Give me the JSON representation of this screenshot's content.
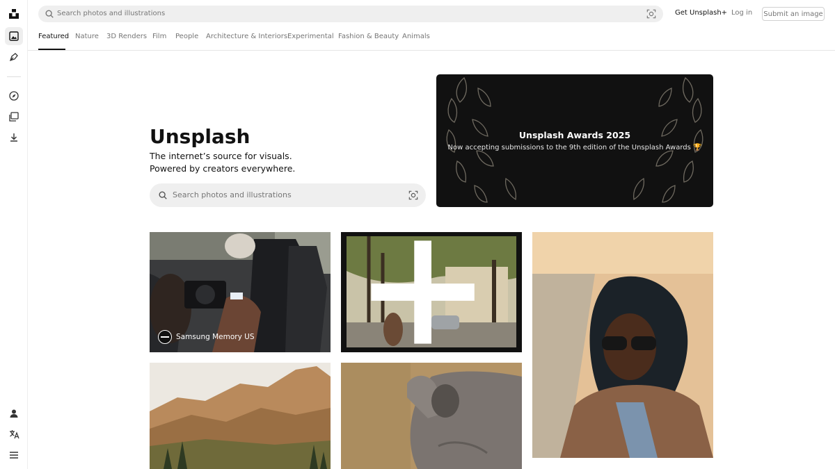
{
  "header": {
    "search_placeholder": "Search photos and illustrations",
    "get_plus": "Get Unsplash+",
    "login": "Log in",
    "submit": "Submit an image"
  },
  "tabs": [
    "Featured",
    "Nature",
    "3D Renders",
    "Film",
    "People",
    "Architecture & Interiors",
    "Experimental",
    "Fashion & Beauty",
    "Animals"
  ],
  "hero": {
    "title": "Unsplash",
    "subtitle_line1": "The internet’s source for visuals.",
    "subtitle_line2": "Powered by creators everywhere.",
    "search_placeholder": "Search photos and illustrations"
  },
  "awards": {
    "title": "Unsplash Awards 2025",
    "subtitle": "Now accepting submissions to the 9th edition of the Unsplash Awards 🏆"
  },
  "photos": {
    "car_photo": {
      "credit": "Samsung Memory US"
    }
  },
  "rail": {
    "items": [
      "logo-icon",
      "photos-icon",
      "illustrations-icon",
      "explore-icon",
      "collections-icon",
      "download-icon",
      "user-icon",
      "language-icon",
      "menu-icon"
    ]
  },
  "colors": {
    "text": "#111111",
    "muted": "#767676",
    "search_bg": "#efefef",
    "banner_bg": "#111111"
  }
}
